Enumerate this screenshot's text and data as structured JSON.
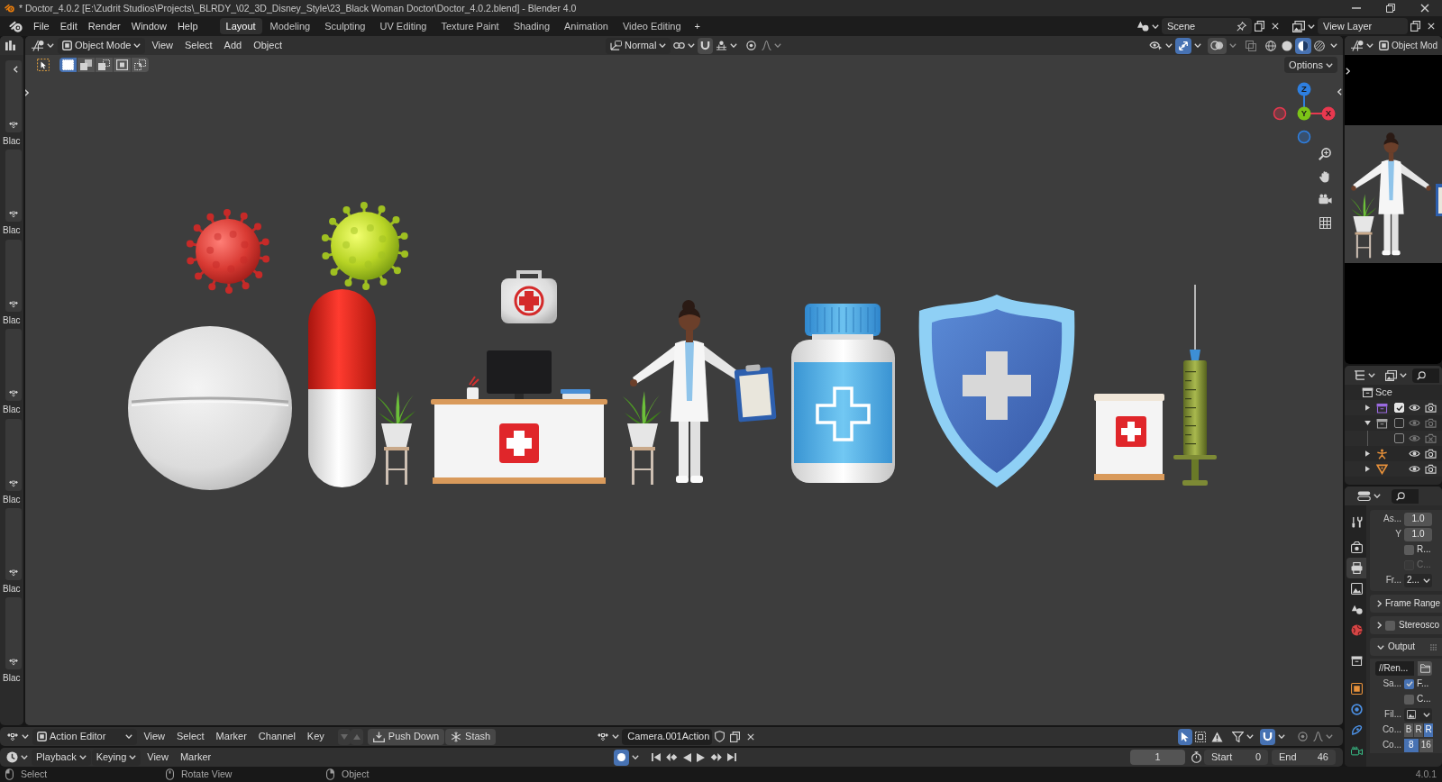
{
  "window": {
    "title": "* Doctor_4.0.2 [E:\\Zudrit Studios\\Projects\\_BLRDY_\\02_3D_Disney_Style\\23_Black Woman Doctor\\Doctor_4.0.2.blend] - Blender 4.0"
  },
  "top_bar": {
    "menus": [
      "File",
      "Edit",
      "Render",
      "Window",
      "Help"
    ],
    "workspaces": [
      {
        "label": "Layout",
        "selected": true
      },
      {
        "label": "Modeling",
        "selected": false
      },
      {
        "label": "Sculpting",
        "selected": false
      },
      {
        "label": "UV Editing",
        "selected": false
      },
      {
        "label": "Texture Paint",
        "selected": false
      },
      {
        "label": "Shading",
        "selected": false
      },
      {
        "label": "Animation",
        "selected": false
      },
      {
        "label": "Video Editing",
        "selected": false
      }
    ],
    "add_workspace": "+",
    "scene": "Scene",
    "view_layer": "View Layer"
  },
  "asset_shelf": {
    "items": [
      {
        "label": "Blac"
      },
      {
        "label": "Blac"
      },
      {
        "label": "Blac"
      },
      {
        "label": "Blac"
      },
      {
        "label": "Blac"
      },
      {
        "label": "Blac"
      },
      {
        "label": "Blac"
      }
    ]
  },
  "viewport": {
    "mode": "Object Mode",
    "menus": [
      "View",
      "Select",
      "Add",
      "Object"
    ],
    "orientation": "Normal",
    "show_gizmos": true,
    "shading": [
      {
        "kind": "wireframe",
        "selected": false
      },
      {
        "kind": "solid",
        "selected": false
      },
      {
        "kind": "material",
        "selected": true
      },
      {
        "kind": "rendered",
        "selected": false
      }
    ],
    "select_modes": [
      {
        "kind": "set",
        "selected": true
      },
      {
        "kind": "extend",
        "selected": false
      },
      {
        "kind": "subtract",
        "selected": false
      },
      {
        "kind": "invert",
        "selected": false
      },
      {
        "kind": "intersect",
        "selected": false
      }
    ],
    "options": "Options",
    "gizmo_axes": [
      {
        "label": "Z",
        "color": "#2e7fe0"
      },
      {
        "label": "Y",
        "color": "#7cc417"
      },
      {
        "label": "X",
        "color": "#e8384f"
      }
    ]
  },
  "camera_view": {
    "mode": "Object Mod"
  },
  "outliner": {
    "root": "Sce",
    "items": [
      {
        "kind": "collection",
        "color": "#9a6ae0",
        "expanded": false,
        "checked": true,
        "renderable": true
      },
      {
        "kind": "collection",
        "color": "#a3a3a3",
        "expanded": true,
        "checked": false,
        "renderable": true,
        "children": [
          {
            "checked": false,
            "renderable": false
          }
        ]
      },
      {
        "kind": "armature",
        "expanded": false,
        "renderable": true
      },
      {
        "kind": "mesh",
        "expanded": false,
        "renderable": true
      }
    ]
  },
  "properties": {
    "tabs": [
      {
        "kind": "tool",
        "selected": false
      },
      {
        "kind": "render",
        "selected": false
      },
      {
        "kind": "output",
        "selected": true
      },
      {
        "kind": "view_layer",
        "selected": false
      },
      {
        "kind": "scene",
        "selected": false
      },
      {
        "kind": "world",
        "selected": false
      },
      {
        "kind": "collection",
        "selected": false
      },
      {
        "kind": "object",
        "selected": false
      },
      {
        "kind": "physics",
        "selected": false
      },
      {
        "kind": "constraints",
        "selected": false
      },
      {
        "kind": "camera_data",
        "selected": false
      }
    ],
    "format": [
      {
        "kind": "number",
        "label": "As...",
        "value": "1.0"
      },
      {
        "kind": "number",
        "label": "Y",
        "value": "1.0"
      },
      {
        "kind": "checkbox",
        "text": "R...",
        "checked": false,
        "disabled": false
      },
      {
        "kind": "checkbox",
        "text": "C...",
        "checked": false,
        "disabled": true
      },
      {
        "kind": "dropdown",
        "label": "Fr...",
        "value": "2..."
      }
    ],
    "panels": [
      {
        "title": "Frame Range",
        "expanded": false
      },
      {
        "title": "Stereosco",
        "expanded": false,
        "checked": false
      },
      {
        "title": "Output",
        "expanded": true,
        "rows": [
          {
            "kind": "path",
            "value": "//Ren..."
          },
          {
            "kind": "checkbox",
            "label": "Sa...",
            "text": "F...",
            "checked": true,
            "disabled": false
          },
          {
            "kind": "checkbox",
            "text": "C...",
            "checked": false,
            "disabled": false
          },
          {
            "kind": "image_dropdown",
            "label": "Fil..."
          },
          {
            "kind": "segmented",
            "label": "Co...",
            "options": [
              {
                "label": "B",
                "selected": false
              },
              {
                "label": "R",
                "selected": false
              },
              {
                "label": "R",
                "selected": true
              }
            ]
          },
          {
            "kind": "segmented",
            "label": "Co...",
            "options": [
              {
                "label": "8",
                "selected": true
              },
              {
                "label": "16",
                "selected": false
              }
            ]
          }
        ]
      }
    ]
  },
  "action_editor": {
    "mode": "Action Editor",
    "menus": [
      "View",
      "Select",
      "Marker",
      "Channel",
      "Key"
    ],
    "push_down": "Push Down",
    "stash": "Stash",
    "action": "Camera.001Action",
    "only_selected": true,
    "show_hidden": false,
    "only_errors": false,
    "snapping": true
  },
  "timeline": {
    "menus": [
      {
        "label": "Playback",
        "dropdown": true
      },
      {
        "label": "Keying",
        "dropdown": true
      },
      {
        "label": "View",
        "dropdown": false
      },
      {
        "label": "Marker",
        "dropdown": false
      }
    ],
    "auto_keying": true,
    "current_frame": "1",
    "start_label": "Start",
    "start": "0",
    "end_label": "End",
    "end": "46"
  },
  "status_bar": {
    "hints": [
      {
        "kind": "left_click",
        "text": "Select"
      },
      {
        "kind": "middle_click",
        "text": "Rotate View"
      },
      {
        "kind": "right_click",
        "text": "Object"
      }
    ],
    "version": "4.0.1"
  }
}
